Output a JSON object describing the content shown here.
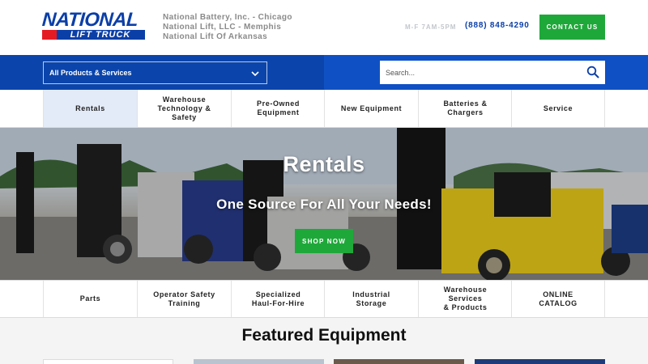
{
  "header": {
    "logo_text_top": "NATIONAL",
    "logo_text_bottom": "LIFT TRUCK",
    "companies": [
      "National Battery, Inc. - Chicago",
      "National Lift, LLC - Memphis",
      "National Lift Of Arkansas"
    ],
    "hours": "M-F 7AM-5PM",
    "phone": "(888) 848-4290",
    "contact_label": "CONTACT US"
  },
  "toolbar": {
    "select_value": "All Products & Services",
    "search_placeholder": "Search..."
  },
  "nav_top": [
    {
      "label": "Rentals"
    },
    {
      "label": "Warehouse\nTechnology &\nSafety"
    },
    {
      "label": "Pre-Owned\nEquipment"
    },
    {
      "label": "New Equipment"
    },
    {
      "label": "Batteries &\nChargers"
    },
    {
      "label": "Service"
    }
  ],
  "hero": {
    "title": "Rentals",
    "subtitle": "One Source For All Your Needs!",
    "button_label": "SHOP NOW"
  },
  "nav_bottom": [
    {
      "label": "Parts"
    },
    {
      "label": "Operator Safety\nTraining"
    },
    {
      "label": "Specialized\nHaul-For-Hire"
    },
    {
      "label": "Industrial\nStorage"
    },
    {
      "label": "Warehouse\nServices\n& Products"
    },
    {
      "label": "ONLINE\nCATALOG"
    }
  ],
  "featured": {
    "title": "Featured Equipment"
  },
  "colors": {
    "brand_blue": "#0b3fa8",
    "bar_blue": "#0f51c4",
    "accent_green": "#1fa83a",
    "active_tab": "#e3ebf8"
  }
}
